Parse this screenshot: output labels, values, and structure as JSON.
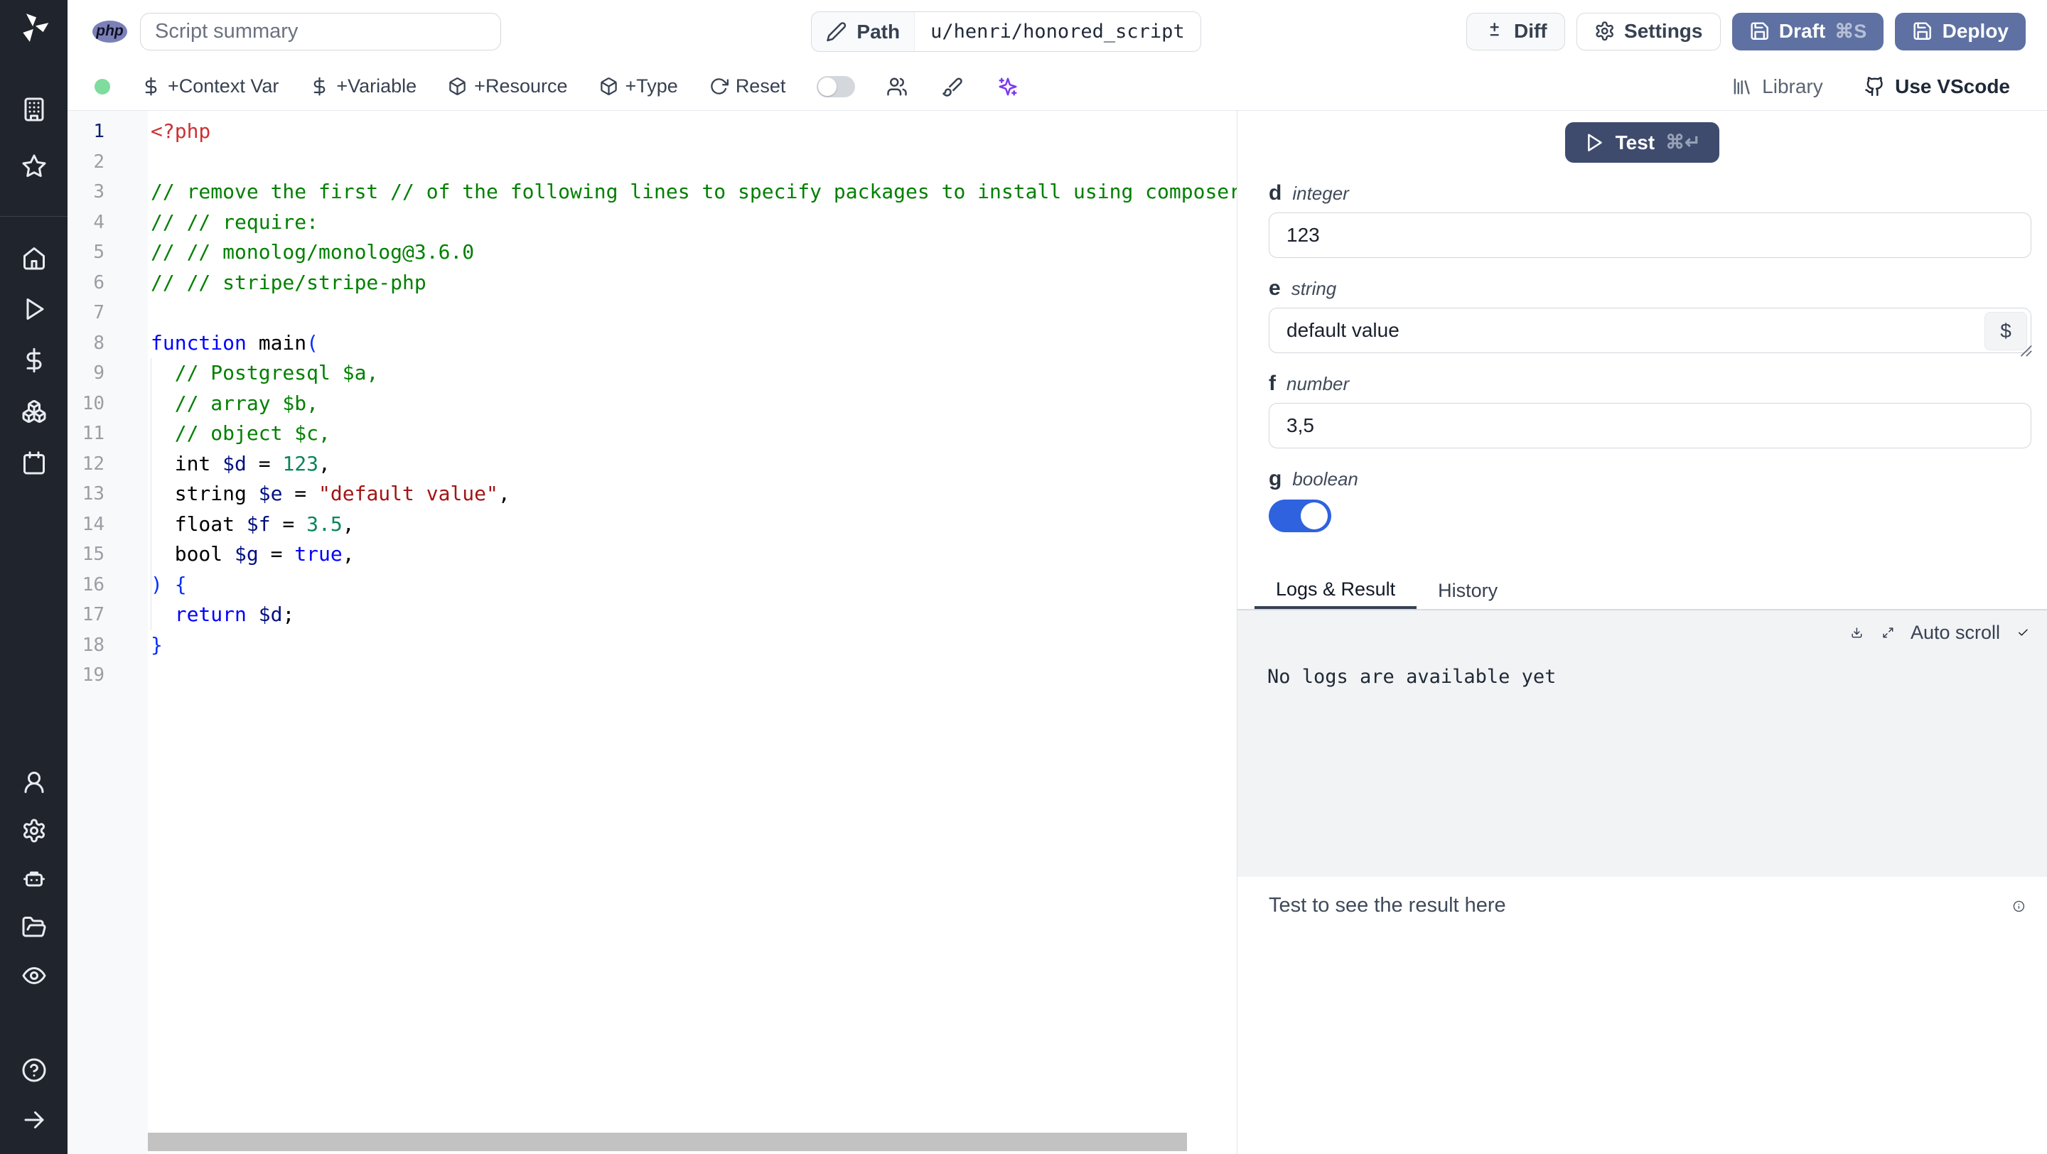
{
  "topbar": {
    "language_badge": "php",
    "summary_placeholder": "Script summary",
    "path": {
      "icon": "pencil-icon",
      "label": "Path",
      "value": "u/henri/honored_script"
    },
    "actions": {
      "diff": {
        "icon": "diff-icon",
        "label": "Diff"
      },
      "settings": {
        "icon": "gear-icon",
        "label": "Settings"
      },
      "draft": {
        "icon": "save-icon",
        "label": "Draft",
        "shortcut": "⌘S"
      },
      "deploy": {
        "icon": "save-icon",
        "label": "Deploy"
      }
    }
  },
  "toolbar": {
    "buttons": [
      {
        "icon": "dollar-icon",
        "label": "+Context Var"
      },
      {
        "icon": "dollar-icon",
        "label": "+Variable"
      },
      {
        "icon": "package-icon",
        "label": "+Resource"
      },
      {
        "icon": "package-icon",
        "label": "+Type"
      },
      {
        "icon": "reset-icon",
        "label": "Reset"
      }
    ],
    "toggle_on": false,
    "icon_buttons": [
      {
        "icon": "users-icon"
      },
      {
        "icon": "brush-icon"
      },
      {
        "icon": "sparkles-icon",
        "accent": true
      }
    ],
    "library": {
      "icon": "library-icon",
      "label": "Library"
    },
    "vscode": {
      "icon": "github-icon",
      "label": "Use VScode"
    }
  },
  "sidebar": {
    "groups": {
      "top": [
        {
          "icon": "building-icon"
        },
        {
          "icon": "star-icon"
        }
      ],
      "main": [
        {
          "icon": "home-icon"
        },
        {
          "icon": "play-icon"
        },
        {
          "icon": "dollar-icon"
        },
        {
          "icon": "boxes-icon"
        },
        {
          "icon": "calendar-icon"
        }
      ],
      "lower": [
        {
          "icon": "user-icon"
        },
        {
          "icon": "gear-icon"
        },
        {
          "icon": "bot-icon"
        },
        {
          "icon": "folder-open-icon"
        },
        {
          "icon": "eye-icon"
        }
      ],
      "bottom": [
        {
          "icon": "help-icon"
        },
        {
          "icon": "arrow-right-icon"
        }
      ]
    }
  },
  "editor": {
    "lines": [
      {
        "tokens": [
          [
            "meta",
            "<?php"
          ]
        ]
      },
      {
        "tokens": []
      },
      {
        "tokens": [
          [
            "cm",
            "// remove the first // of the following lines to specify packages to install using composer"
          ]
        ]
      },
      {
        "tokens": [
          [
            "cm",
            "// // require:"
          ]
        ]
      },
      {
        "tokens": [
          [
            "cm",
            "// // monolog/monolog@3.6.0"
          ]
        ]
      },
      {
        "tokens": [
          [
            "cm",
            "// // stripe/stripe-php"
          ]
        ]
      },
      {
        "tokens": []
      },
      {
        "tokens": [
          [
            "kw",
            "function"
          ],
          [
            "pl",
            " main"
          ],
          [
            "br",
            "("
          ]
        ]
      },
      {
        "tokens": [
          [
            "pl",
            "  "
          ],
          [
            "cm",
            "// Postgresql $a,"
          ]
        ]
      },
      {
        "tokens": [
          [
            "pl",
            "  "
          ],
          [
            "cm",
            "// array $b,"
          ]
        ]
      },
      {
        "tokens": [
          [
            "pl",
            "  "
          ],
          [
            "cm",
            "// object $c,"
          ]
        ]
      },
      {
        "tokens": [
          [
            "pl",
            "  int "
          ],
          [
            "var",
            "$d"
          ],
          [
            "pl",
            " = "
          ],
          [
            "num",
            "123"
          ],
          [
            "pl",
            ","
          ]
        ]
      },
      {
        "tokens": [
          [
            "pl",
            "  string "
          ],
          [
            "var",
            "$e"
          ],
          [
            "pl",
            " = "
          ],
          [
            "str",
            "\"default value\""
          ],
          [
            "pl",
            ","
          ]
        ]
      },
      {
        "tokens": [
          [
            "pl",
            "  float "
          ],
          [
            "var",
            "$f"
          ],
          [
            "pl",
            " = "
          ],
          [
            "num",
            "3.5"
          ],
          [
            "pl",
            ","
          ]
        ]
      },
      {
        "tokens": [
          [
            "pl",
            "  bool "
          ],
          [
            "var",
            "$g"
          ],
          [
            "pl",
            " = "
          ],
          [
            "kw",
            "true"
          ],
          [
            "pl",
            ","
          ]
        ]
      },
      {
        "tokens": [
          [
            "br",
            ") {"
          ]
        ]
      },
      {
        "tokens": [
          [
            "pl",
            "  "
          ],
          [
            "kw",
            "return"
          ],
          [
            "pl",
            " "
          ],
          [
            "var",
            "$d"
          ],
          [
            "pl",
            ";"
          ]
        ]
      },
      {
        "tokens": [
          [
            "br",
            "}"
          ]
        ]
      },
      {
        "tokens": []
      }
    ]
  },
  "panel": {
    "test": {
      "icon": "play-icon",
      "label": "Test",
      "shortcut": "⌘↵"
    },
    "fields": {
      "d": {
        "name": "d",
        "type": "integer",
        "value": "123"
      },
      "e": {
        "name": "e",
        "type": "string",
        "value": "default value",
        "button": "$"
      },
      "f": {
        "name": "f",
        "type": "number",
        "value": "3,5"
      },
      "g": {
        "name": "g",
        "type": "boolean",
        "value": true
      }
    },
    "tabs": [
      {
        "label": "Logs & Result",
        "active": true
      },
      {
        "label": "History",
        "active": false
      }
    ],
    "logs": {
      "download_icon": "download-icon",
      "expand_icon": "expand-icon",
      "auto_scroll_label": "Auto scroll",
      "check_icon": "check-icon",
      "empty_message": "No logs are available yet"
    },
    "result": {
      "placeholder": "Test to see the result here",
      "info_icon": "info-icon"
    }
  },
  "colors": {
    "sidebar_bg": "#1f242d",
    "primary_button": "#5e71a2",
    "test_button": "#3e4b6d",
    "toggle_on": "#2f62de",
    "status_dot": "#7edc9c",
    "code": {
      "meta": "#cd3131",
      "comment": "#008000",
      "keyword": "#0000ff",
      "string": "#a31515",
      "number": "#098658",
      "variable": "#001080",
      "bracket": "#0431fa"
    }
  }
}
